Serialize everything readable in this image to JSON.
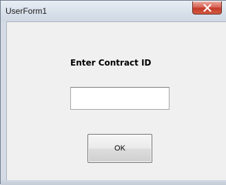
{
  "window": {
    "title": "UserForm1",
    "close_icon": "close-icon",
    "close_button_color": "#c84a35"
  },
  "form": {
    "prompt_label": "Enter Contract ID",
    "contract_id_input": {
      "value": "",
      "placeholder": ""
    },
    "ok_button_label": "OK"
  }
}
